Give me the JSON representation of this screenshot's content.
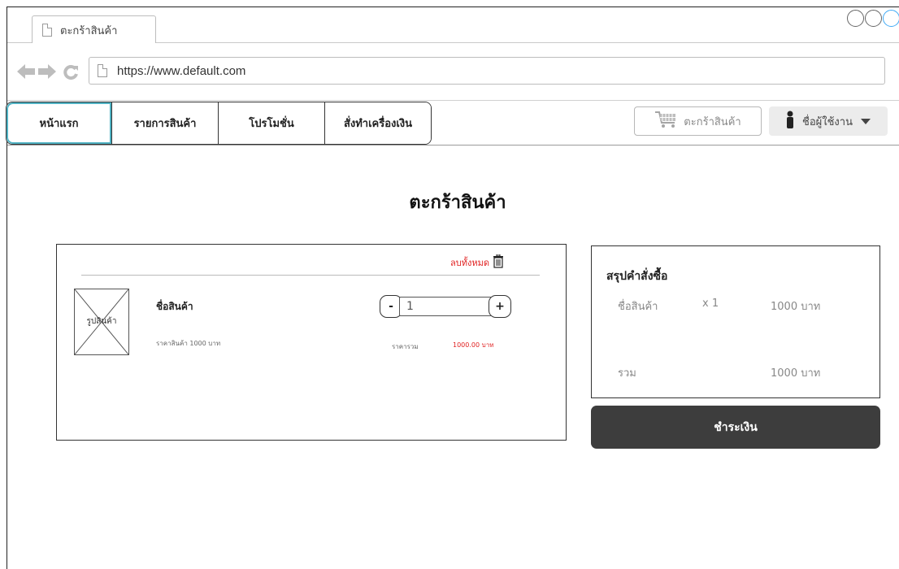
{
  "browser": {
    "tab_title": "ตะกร้าสินค้า",
    "url": "https://www.default.com"
  },
  "nav": {
    "items": [
      {
        "label": "หน้าแรก"
      },
      {
        "label": "รายการสินค้า"
      },
      {
        "label": "โปรโมชั่น"
      },
      {
        "label": "สั่งทำเครื่องเงิน"
      }
    ],
    "cart_label": "ตะกร้าสินค้า",
    "user_label": "ชื่อผู้ใช้งาน"
  },
  "page": {
    "title": "ตะกร้าสินค้า"
  },
  "cart": {
    "delete_all": "ลบทั้งหมด",
    "image_placeholder": "รูปสินค้า",
    "product_name": "ชื่อสินค้า",
    "product_price": "ราคาสินค้า 1000 บาท",
    "quantity": "1",
    "minus": "-",
    "plus": "+",
    "total_label": "ราคารวม",
    "total_value": "1000.00 บาท"
  },
  "summary": {
    "title": "สรุปคำสั่งซื้อ",
    "item_name": "ชื่อสินค้า",
    "item_qty": "x 1",
    "item_price": "1000 บาท",
    "total_label": "รวม",
    "total_value": "1000 บาท"
  },
  "pay_button": "ชำระเงิน",
  "colors": {
    "accent_red": "#e02020",
    "pay_button_bg": "#3d3d3d",
    "active_tab_border": "#4fb2c3"
  }
}
